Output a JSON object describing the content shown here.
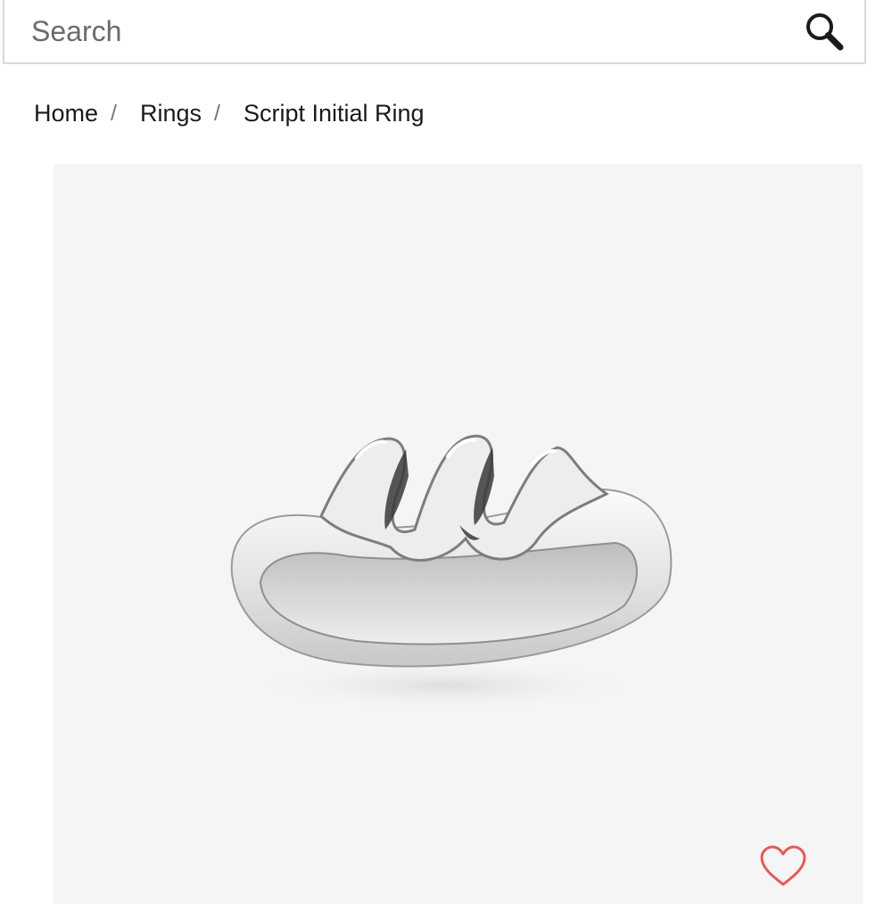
{
  "search": {
    "placeholder": "Search",
    "value": ""
  },
  "breadcrumb": {
    "items": [
      {
        "label": "Home"
      },
      {
        "label": "Rings"
      }
    ],
    "separator": "/",
    "current": "Script Initial Ring"
  },
  "colors": {
    "search_border": "#d9d9d9",
    "image_background": "#f5f5f5",
    "wishlist_heart": "#e25b5b",
    "text": "#1a1a1a"
  },
  "icons": {
    "search": "search-icon",
    "wishlist": "heart-outline-icon"
  }
}
